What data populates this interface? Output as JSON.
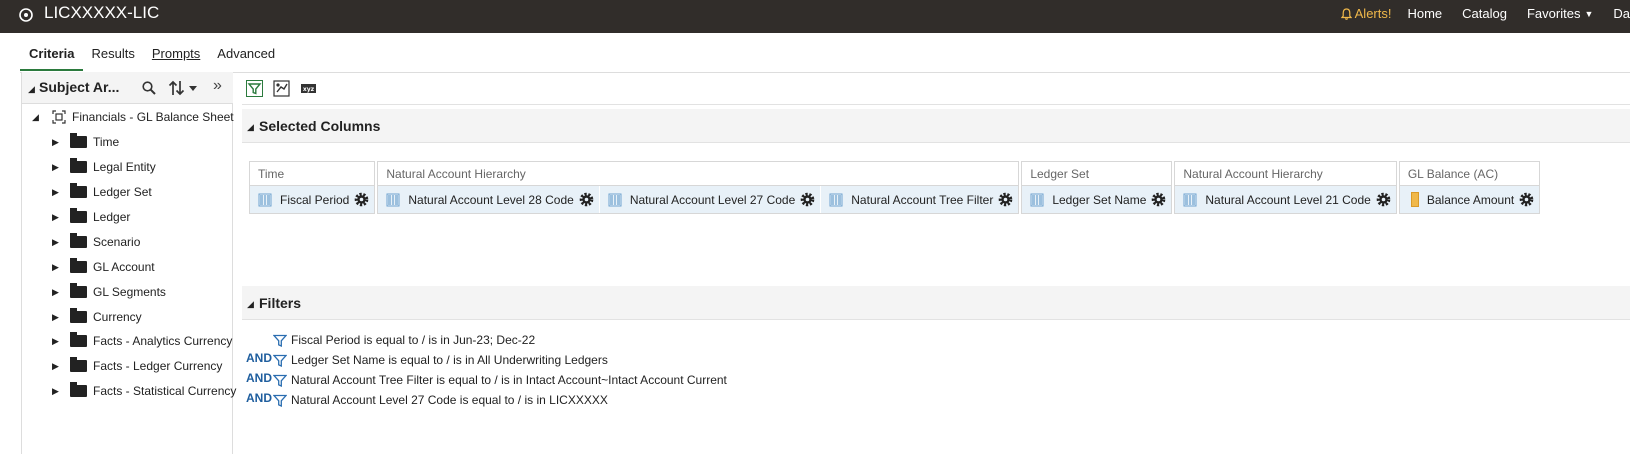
{
  "header": {
    "title": "LICXXXXX-LIC",
    "alerts_label": "Alerts!",
    "nav": [
      "Home",
      "Catalog",
      "Favorites",
      "Da"
    ]
  },
  "tabs": [
    "Criteria",
    "Results",
    "Prompts",
    "Advanced"
  ],
  "subject_area": {
    "title": "Subject Ar...",
    "root": "Financials - GL Balance Sheet",
    "folders": [
      "Time",
      "Legal Entity",
      "Ledger Set",
      "Ledger",
      "Scenario",
      "GL Account",
      "GL Segments",
      "Currency",
      "Facts - Analytics Currency",
      "Facts - Ledger Currency",
      "Facts - Statistical Currency"
    ]
  },
  "selected_columns": {
    "title": "Selected Columns",
    "groups": [
      {
        "header": "Time",
        "columns": [
          "Fiscal Period"
        ]
      },
      {
        "header": "Natural Account Hierarchy",
        "columns": [
          "Natural Account Level 28 Code",
          "Natural Account Level 27 Code",
          "Natural Account Tree Filter"
        ]
      },
      {
        "header": "Ledger Set",
        "columns": [
          "Ledger Set Name"
        ]
      },
      {
        "header": "Natural Account Hierarchy",
        "columns": [
          "Natural Account Level 21 Code"
        ]
      },
      {
        "header": "GL Balance (AC)",
        "columns": [
          "Balance Amount"
        ]
      }
    ]
  },
  "filters": {
    "title": "Filters",
    "and_label": "AND",
    "items": [
      "Fiscal Period is equal to / is in  Jun-23; Dec-22",
      "Ledger Set Name is equal to / is in  All Underwriting Ledgers",
      "Natural Account Tree Filter is equal to / is in  Intact Account~Intact Account Current",
      "Natural Account Level 27 Code is equal to / is in  LICXXXXX"
    ]
  },
  "colors": {
    "topbar": "#312d2a",
    "alert": "#f0b84a",
    "active_tab": "#2b7a3d",
    "column_bg": "#e8f1f8",
    "and": "#1f5e9e"
  }
}
